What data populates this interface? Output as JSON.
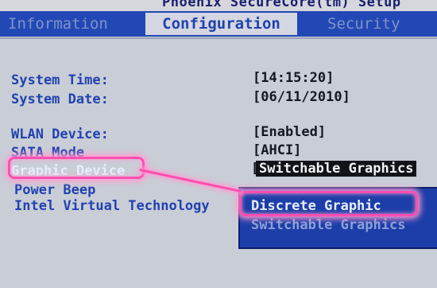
{
  "title": "Phoenix SecureCore(tm) Setup",
  "tabs": [
    {
      "label": "Information"
    },
    {
      "label": "Configuration"
    },
    {
      "label": "Security"
    }
  ],
  "fields": {
    "system_time": {
      "label": "System Time:",
      "value": "[14:15:20]"
    },
    "system_date": {
      "label": "System Date:",
      "value": "[06/11/2010]"
    },
    "wlan_device": {
      "label": "WLAN Device:",
      "value": "[Enabled]"
    },
    "sata_mode": {
      "label": "SATA Mode",
      "value": "[AHCI]"
    },
    "graphic_device": {
      "label": "Graphic Device",
      "value": "Switchable Graphics"
    },
    "power_beep": {
      "label": "Power Beep"
    },
    "intel_virtual_technology": {
      "label": "Intel Virtual Technology"
    }
  },
  "popup": {
    "options": [
      "Discrete Graphic",
      "Switchable Graphics"
    ]
  },
  "colors": {
    "tab_bar": "#2248b5",
    "label": "#2242b0",
    "highlight": "#ff4fb0"
  }
}
